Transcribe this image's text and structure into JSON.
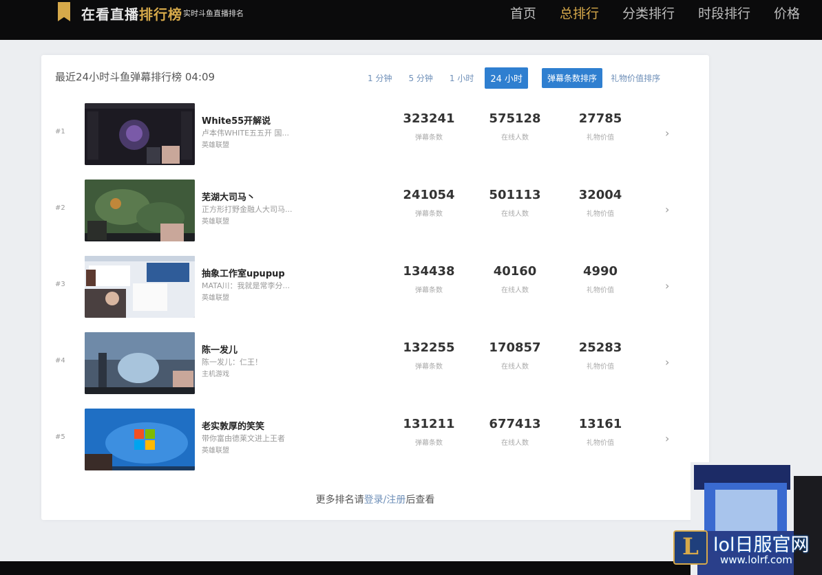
{
  "header": {
    "brand_plain": "在看直播",
    "brand_highlight": "排行榜",
    "brand_sub": "实时斗鱼直播排名",
    "nav": [
      "首页",
      "总排行",
      "分类排行",
      "时段排行",
      "价格"
    ],
    "active_nav": 1,
    "accent_color": "#d6a94a"
  },
  "main": {
    "title": "最近24小时斗鱼弹幕排行榜 04:09",
    "time_filters": [
      "1 分钟",
      "5 分钟",
      "1 小时",
      "24 小时"
    ],
    "active_time_filter": 3,
    "sort_options": [
      "弹幕条数排序",
      "礼物价值排序"
    ],
    "active_sort": 0,
    "stat_labels": [
      "弹幕条数",
      "在线人数",
      "礼物价值"
    ],
    "rows": [
      {
        "rank": "#1",
        "name": "White55开解说",
        "desc": "卢本伟WHITE五五开 国...",
        "category": "英雄联盟",
        "danmu": "323241",
        "online": "575128",
        "gift": "27785"
      },
      {
        "rank": "#2",
        "name": "芜湖大司马丶",
        "desc": "正方形打野金融人大司马...",
        "category": "英雄联盟",
        "danmu": "241054",
        "online": "501113",
        "gift": "32004"
      },
      {
        "rank": "#3",
        "name": "抽象工作室upupup",
        "desc": "MATA川：我就是常李分...",
        "category": "英雄联盟",
        "danmu": "134438",
        "online": "40160",
        "gift": "4990"
      },
      {
        "rank": "#4",
        "name": "陈一发儿",
        "desc": "陈一发儿：仁王！",
        "category": "主机游戏",
        "danmu": "132255",
        "online": "170857",
        "gift": "25283"
      },
      {
        "rank": "#5",
        "name": "老实敦厚的笑笑",
        "desc": "带你富由德莱文进上王者",
        "category": "英雄联盟",
        "danmu": "131211",
        "online": "677413",
        "gift": "13161"
      }
    ],
    "more_prefix": "更多排名请",
    "login_link": "登录",
    "separator": "/",
    "register_link": "注册",
    "more_suffix": "后查看"
  },
  "watermark": {
    "logo_letter": "L",
    "title": "lol日服官网",
    "url": "www.lolrf.com"
  }
}
